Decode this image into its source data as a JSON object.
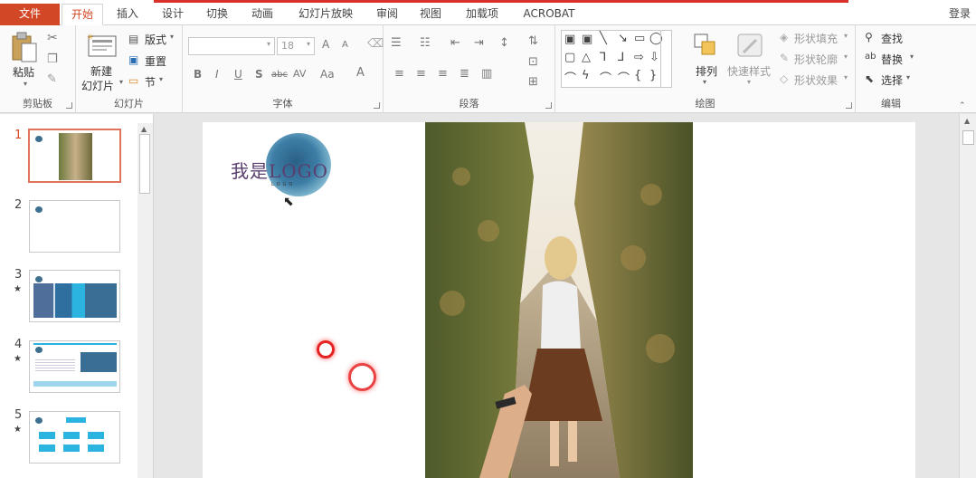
{
  "tabs": {
    "file": "文件",
    "items": [
      "开始",
      "插入",
      "设计",
      "切换",
      "动画",
      "幻灯片放映",
      "审阅",
      "视图",
      "加载项",
      "ACROBAT"
    ],
    "active_index": 0,
    "login": "登录"
  },
  "ribbon": {
    "clipboard": {
      "paste": "粘贴",
      "label": "剪贴板"
    },
    "slides": {
      "new_slide_line1": "新建",
      "new_slide_line2": "幻灯片",
      "layout": "版式",
      "reset": "重置",
      "section": "节",
      "label": "幻灯片"
    },
    "font": {
      "font_name": "",
      "font_size": "18",
      "label": "字体",
      "bold": "B",
      "italic": "I",
      "underline": "U",
      "shadow": "S",
      "strike": "abc",
      "spacing": "AV",
      "case": "Aa",
      "color": "A",
      "grow": "A",
      "shrink": "A"
    },
    "paragraph": {
      "label": "段落"
    },
    "drawing": {
      "arrange": "排列",
      "quick_styles": "快速样式",
      "fill": "形状填充",
      "outline": "形状轮廓",
      "effects": "形状效果",
      "label": "绘图"
    },
    "editing": {
      "find": "查找",
      "replace": "替换",
      "select": "选择",
      "label": "编辑"
    }
  },
  "slide_numbers": [
    "1",
    "2",
    "3",
    "4",
    "5"
  ],
  "slide_stars": [
    "★",
    "★",
    "★"
  ],
  "slide_content": {
    "logo_text": "我是LOGO",
    "logo_sub": "LOGO"
  },
  "colors": {
    "accent": "#d24726",
    "selection_border": "#e0735b",
    "click_ring": "#e52222"
  }
}
